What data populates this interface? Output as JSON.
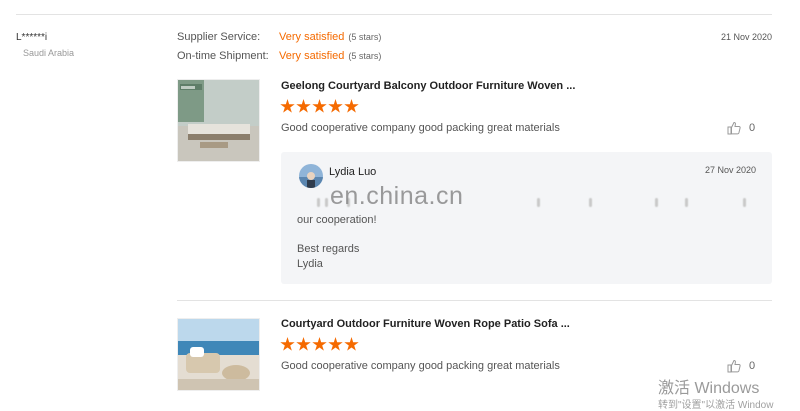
{
  "reviewer": {
    "name": "L******i",
    "country": "Saudi Arabia"
  },
  "ratings": [
    {
      "label": "Supplier Service:",
      "value": "Very satisfied",
      "stars": "(5 stars)"
    },
    {
      "label": "On-time Shipment:",
      "value": "Very satisfied",
      "stars": "(5 stars)"
    }
  ],
  "review_date": "21 Nov 2020",
  "products": [
    {
      "title": "Geelong Courtyard Balcony Outdoor Furniture Woven ...",
      "rating": 5,
      "comment": "Good cooperative company good packing great materials",
      "like_count": "0",
      "icon": "thumbs-up-icon"
    },
    {
      "title": "Courtyard Outdoor Furniture Woven Rope Patio Sofa ...",
      "rating": 5,
      "comment": "Good cooperative company good packing great materials",
      "like_count": "0",
      "icon": "thumbs-up-icon"
    }
  ],
  "reply": {
    "name": "Lydia Luo",
    "date": "27 Nov 2020",
    "watermark": "en.china.cn",
    "line1": "our cooperation!",
    "line2": "Best regards",
    "line3": "Lydia"
  },
  "windows_activation": {
    "title": "激活 Windows",
    "subtitle": "转到\"设置\"以激活 Window"
  },
  "colors": {
    "accent": "#f56a00",
    "divider": "#e3e3e3",
    "reply_bg": "#f4f5f7"
  }
}
